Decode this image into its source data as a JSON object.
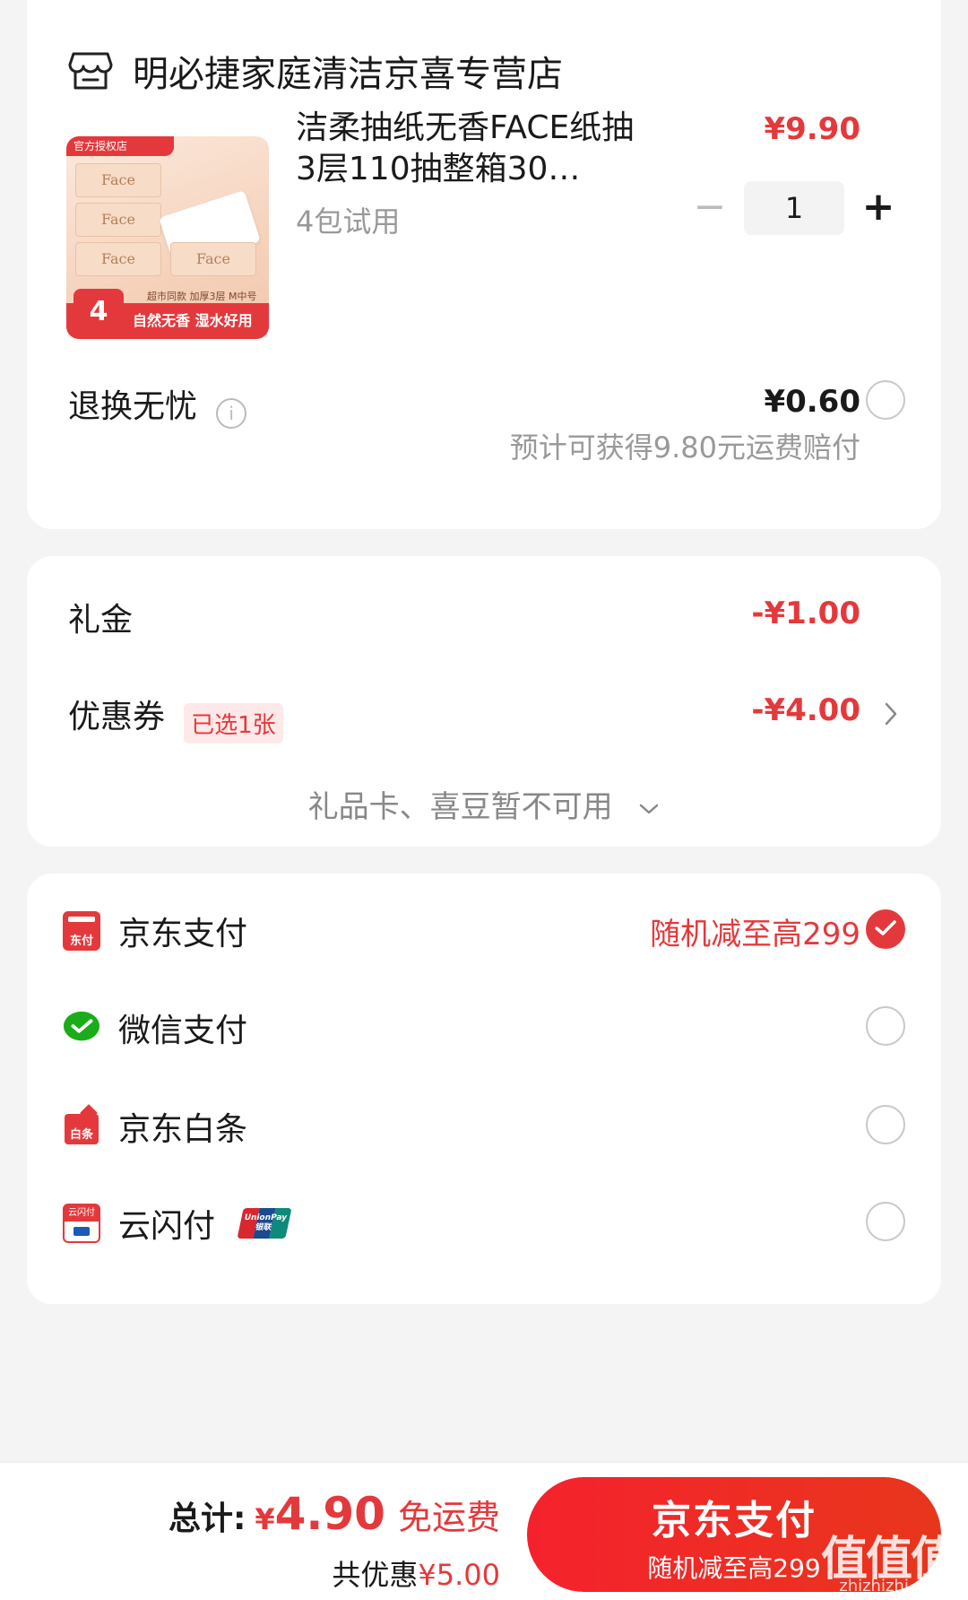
{
  "shop": {
    "name": "明必捷家庭清洁京喜专营店",
    "icon": "store-icon"
  },
  "product": {
    "image_tag_top": "官方授权店",
    "image_pack_label": "Face",
    "image_badge_count": "4",
    "image_badge_text": "自然无香 湿水好用",
    "image_badge_small": "超市同款 加厚3层 M中号",
    "title": "洁柔抽纸无香FACE纸抽3层110抽整箱30…",
    "spec": "4包试用",
    "price": "¥9.90",
    "quantity": "1",
    "minus": "−",
    "plus": "+"
  },
  "return_service": {
    "label": "退换无忧",
    "info": "i",
    "price": "¥0.60",
    "note": "预计可获得9.80元运费赔付",
    "checked": false
  },
  "discounts": {
    "gift_label": "礼金",
    "gift_value": "-¥1.00",
    "coupon_label": "优惠券",
    "coupon_tag": "已选1张",
    "coupon_value": "-¥4.00",
    "unavailable": "礼品卡、喜豆暂不可用"
  },
  "payment": {
    "methods": [
      {
        "label": "京东支付",
        "icon": "jd-pay-icon",
        "promo": "随机减至高299",
        "checked": true
      },
      {
        "label": "微信支付",
        "icon": "wechat-pay-icon",
        "promo": "",
        "checked": false
      },
      {
        "label": "京东白条",
        "icon": "jd-baitiao-icon",
        "promo": "",
        "checked": false
      },
      {
        "label": "云闪付",
        "icon": "cloud-quickpass-icon",
        "promo": "",
        "checked": false
      }
    ],
    "unionpay_badge": "UnionPay 银联"
  },
  "summary": {
    "total_label": "总计:",
    "yen": "¥",
    "total_amount": "4.90",
    "free_shipping": "免运费",
    "saved_label": "共优惠",
    "saved_amount": "¥5.00",
    "pay_button": "京东支付",
    "pay_button_sub": "随机减至高299"
  },
  "watermark": {
    "text": "值值值",
    "site": "zhizhizhi.com"
  },
  "colors": {
    "accent": "#e4393c",
    "background": "#f4f4f4",
    "wechat_green": "#1aad19"
  }
}
